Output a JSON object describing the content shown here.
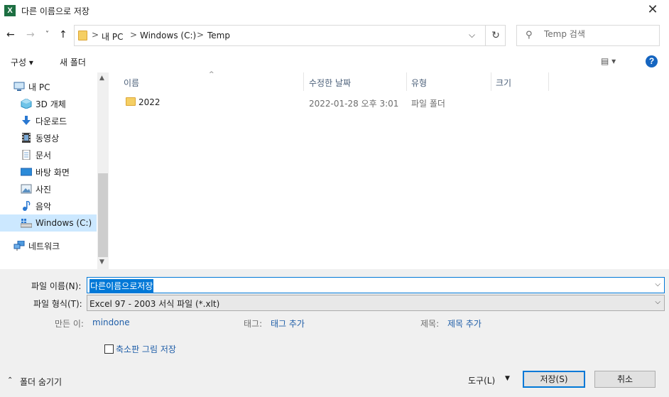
{
  "window": {
    "title": "다른 이름으로 저장",
    "app_icon": "X"
  },
  "nav": {
    "back": "←",
    "forward": "→",
    "recent": "˅",
    "up": "↑",
    "crumbs": [
      "내 PC",
      "Windows (C:)",
      "Temp"
    ],
    "separator": ">",
    "dropdown": "⌵",
    "refresh": "↻"
  },
  "search": {
    "placeholder": "Temp 검색"
  },
  "toolbar": {
    "organize": "구성 ▾",
    "new_folder": "새 폴더",
    "view": "▤ ▾",
    "help": "?"
  },
  "sidebar": {
    "items": [
      {
        "label": "내 PC",
        "icon": "pc-icon"
      },
      {
        "label": "3D 개체",
        "icon": "3d-objects-icon"
      },
      {
        "label": "다운로드",
        "icon": "download-icon"
      },
      {
        "label": "동영상",
        "icon": "video-icon"
      },
      {
        "label": "문서",
        "icon": "document-icon"
      },
      {
        "label": "바탕 화면",
        "icon": "desktop-icon"
      },
      {
        "label": "사진",
        "icon": "pictures-icon"
      },
      {
        "label": "음악",
        "icon": "music-icon"
      },
      {
        "label": "Windows (C:)",
        "icon": "drive-icon"
      },
      {
        "label": "네트워크",
        "icon": "network-icon"
      }
    ],
    "selected_index": 8
  },
  "columns": {
    "name": "이름",
    "modified": "수정한 날짜",
    "type": "유형",
    "size": "크기"
  },
  "files": [
    {
      "name": "2022",
      "modified": "2022-01-28 오후 3:01",
      "type": "파일 폴더",
      "size": ""
    }
  ],
  "form": {
    "filename_label": "파일 이름(N):",
    "filename_value": "다른이름으로저장",
    "filetype_label": "파일 형식(T):",
    "filetype_value": "Excel 97 - 2003 서식 파일 (*.xlt)",
    "author_label": "만든 이:",
    "author_value": "mindone",
    "tags_label": "태그:",
    "tags_value": "태그 추가",
    "subject_label": "제목:",
    "subject_value": "제목 추가",
    "thumbnail_label": "축소판 그림 저장"
  },
  "footer": {
    "hide_folders": "폴더 숨기기",
    "tools": "도구(L)",
    "save": "저장(S)",
    "cancel": "취소"
  },
  "colors": {
    "accent": "#0078d7",
    "link": "#1f5ea8",
    "folder": "#f5cf64"
  }
}
